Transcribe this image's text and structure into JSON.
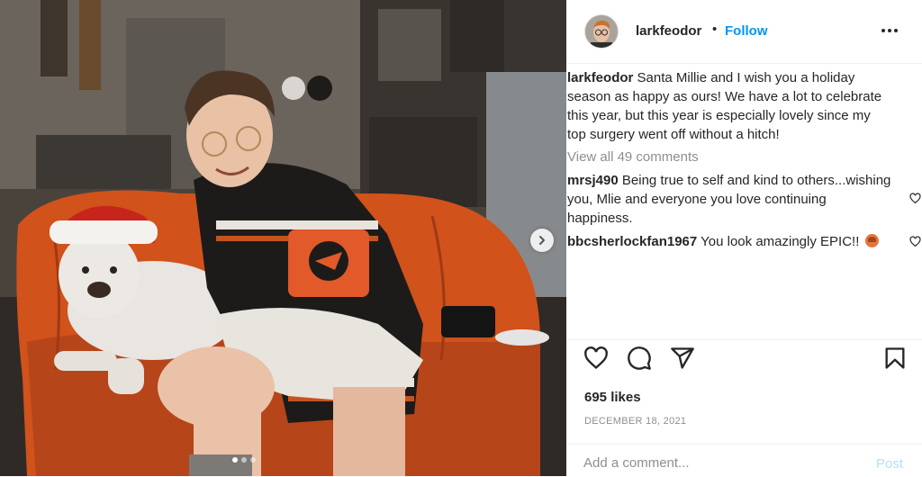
{
  "colors": {
    "accent": "#0095f6",
    "text": "#262626",
    "muted": "#8e8e8e",
    "post_disabled": "#b2dffc"
  },
  "photo": {
    "description_icon": "post-photo",
    "carousel_dots": 3,
    "active_dot": 1
  },
  "header": {
    "username": "larkfeodor",
    "separator": "•",
    "follow_label": "Follow"
  },
  "caption": {
    "username": "larkfeodor",
    "text": "Santa Millie and I wish you a holiday season as happy as ours! We have a lot to celebrate this year, but this year is especially lovely since my top surgery went off without a hitch!"
  },
  "view_all": "View all 49 comments",
  "comments": [
    {
      "username": "mrsj490",
      "text": "Being true to self and kind to others...wishing you, Mlie and everyone you love continuing happiness."
    },
    {
      "username": "bbcsherlockfan1967",
      "text": "You look amazingly EPIC!!"
    }
  ],
  "icons": {
    "like": "heart-icon",
    "comment": "comment-bubble-icon",
    "share": "paper-plane-icon",
    "save": "bookmark-icon",
    "more": "more-options-icon",
    "next": "chevron-right-icon"
  },
  "likes": "695 likes",
  "date": "DECEMBER 18, 2021",
  "add_comment": {
    "placeholder": "Add a comment...",
    "post_label": "Post"
  }
}
